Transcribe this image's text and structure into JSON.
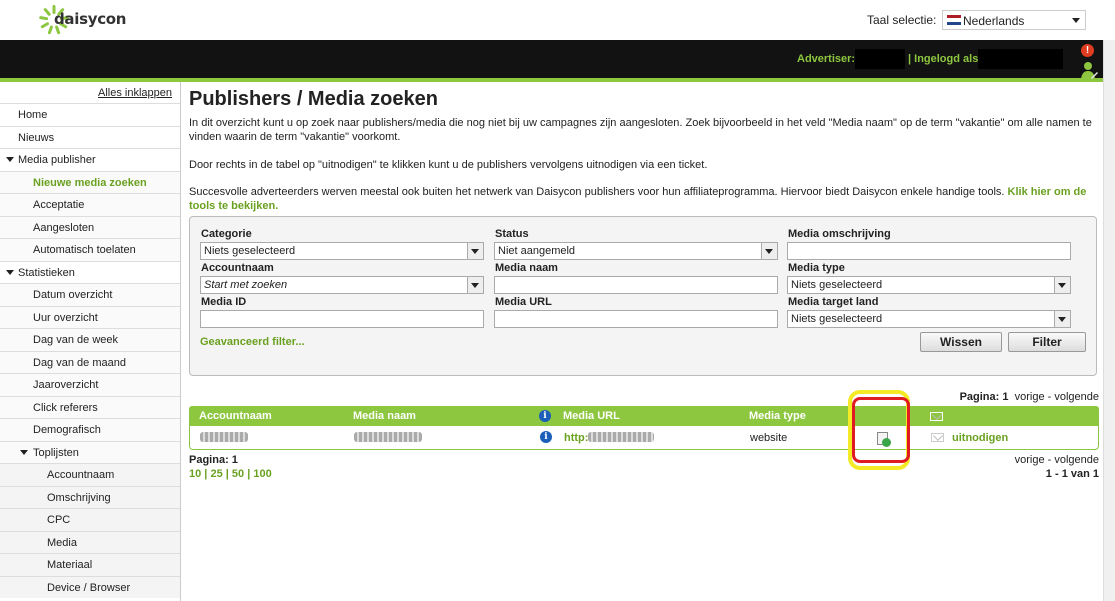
{
  "header": {
    "logo_text": "daisycon",
    "language_label": "Taal selectie:",
    "language_value": "Nederlands",
    "advertiser_label": "Advertiser:",
    "login_label": "| Ingelogd als:",
    "alert_symbol": "!"
  },
  "sidebar": {
    "collapse_all": "Alles inklappen",
    "items": [
      {
        "label": "Home",
        "level": 0,
        "active": false
      },
      {
        "label": "Nieuws",
        "level": 0,
        "active": false
      },
      {
        "label": "Media publisher",
        "level": 0,
        "expanded": true,
        "active": false
      },
      {
        "label": "Nieuwe media zoeken",
        "level": 1,
        "active": true
      },
      {
        "label": "Acceptatie",
        "level": 1,
        "active": false
      },
      {
        "label": "Aangesloten",
        "level": 1,
        "active": false
      },
      {
        "label": "Automatisch toelaten",
        "level": 1,
        "active": false
      },
      {
        "label": "Statistieken",
        "level": 0,
        "expanded": true,
        "active": false
      },
      {
        "label": "Datum overzicht",
        "level": 1,
        "active": false
      },
      {
        "label": "Uur overzicht",
        "level": 1,
        "active": false
      },
      {
        "label": "Dag van de week",
        "level": 1,
        "active": false
      },
      {
        "label": "Dag van de maand",
        "level": 1,
        "active": false
      },
      {
        "label": "Jaaroverzicht",
        "level": 1,
        "active": false
      },
      {
        "label": "Click referers",
        "level": 1,
        "active": false
      },
      {
        "label": "Demografisch",
        "level": 1,
        "active": false
      },
      {
        "label": "Toplijsten",
        "level": 1,
        "expanded": true,
        "active": false
      },
      {
        "label": "Accountnaam",
        "level": 2,
        "active": false
      },
      {
        "label": "Omschrijving",
        "level": 2,
        "active": false
      },
      {
        "label": "CPC",
        "level": 2,
        "active": false
      },
      {
        "label": "Media",
        "level": 2,
        "active": false
      },
      {
        "label": "Materiaal",
        "level": 2,
        "active": false
      },
      {
        "label": "Device / Browser",
        "level": 2,
        "active": false
      }
    ]
  },
  "main": {
    "title": "Publishers / Media zoeken",
    "intro": "In dit overzicht kunt u op zoek naar publishers/media die nog niet bij uw campagnes zijn aangesloten. Zoek bijvoorbeeld in het veld \"Media naam\" op de term \"vakantie\" om alle namen te vinden waarin de term \"vakantie\" voorkomt.",
    "p2": "Door rechts in de tabel op \"uitnodigen\" te klikken kunt u de publishers vervolgens uitnodigen via een ticket.",
    "p3": "Succesvolle adverteerders werven meestal ook buiten het netwerk van Daisycon publishers voor hun affiliateprogramma. Hiervoor biedt Daisycon enkele handige tools.",
    "p3_link": "Klik hier om de tools te bekijken."
  },
  "filter": {
    "categorie_label": "Categorie",
    "categorie_value": "Niets geselecteerd",
    "status_label": "Status",
    "status_value": "Niet aangemeld",
    "omschrijving_label": "Media omschrijving",
    "omschrijving_value": "",
    "accountnaam_label": "Accountnaam",
    "accountnaam_value": "Start met zoeken",
    "medianaam_label": "Media naam",
    "medianaam_value": "",
    "mediatype_label": "Media type",
    "mediatype_value": "Niets geselecteerd",
    "mediaid_label": "Media ID",
    "mediaid_value": "",
    "mediaurl_label": "Media URL",
    "mediaurl_value": "",
    "targetland_label": "Media target land",
    "targetland_value": "Niets geselecteerd",
    "advanced_link": "Geavanceerd filter...",
    "clear_button": "Wissen",
    "filter_button": "Filter"
  },
  "results": {
    "page_label": "Pagina:",
    "page_number": "1",
    "prev_next": "vorige - volgende",
    "columns": [
      "Accountnaam",
      "Media naam",
      "Media URL",
      "Media type"
    ],
    "rows": [
      {
        "media_url_prefix": "http:",
        "media_type": "website",
        "action": "uitnodigen"
      }
    ],
    "page_sizes": [
      "10",
      "25",
      "50",
      "100"
    ],
    "count": "1 - 1 van 1"
  },
  "colors": {
    "brand_green": "#8dc63f",
    "link_green": "#6aa121",
    "header_dark": "#121212",
    "highlight_yellow": "#f4ea25",
    "highlight_red": "#e01b22"
  }
}
